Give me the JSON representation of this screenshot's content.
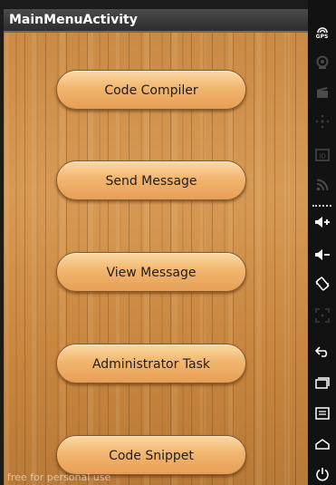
{
  "app": {
    "title": "MainMenuActivity",
    "buttons": [
      {
        "label": "Code Compiler"
      },
      {
        "label": "Send Message"
      },
      {
        "label": "View Message"
      },
      {
        "label": "Administrator Task"
      },
      {
        "label": "Code Snippet"
      }
    ],
    "watermark": "free for personal use"
  },
  "sidebar": {
    "gps_label": "GPS",
    "icons": [
      "gps-icon",
      "camera-icon",
      "film-icon",
      "dpad-icon",
      "id-icon",
      "rss-icon",
      "volume-up-icon",
      "volume-down-icon",
      "rotate-icon",
      "fullscreen-icon",
      "back-icon",
      "recent-apps-icon",
      "menu-icon",
      "home-icon",
      "power-icon"
    ]
  },
  "colors": {
    "button_fill": "#f2b66f",
    "wood": "#c98a45",
    "titlebar": "#3a3a3a",
    "sidebar": "#121212"
  }
}
